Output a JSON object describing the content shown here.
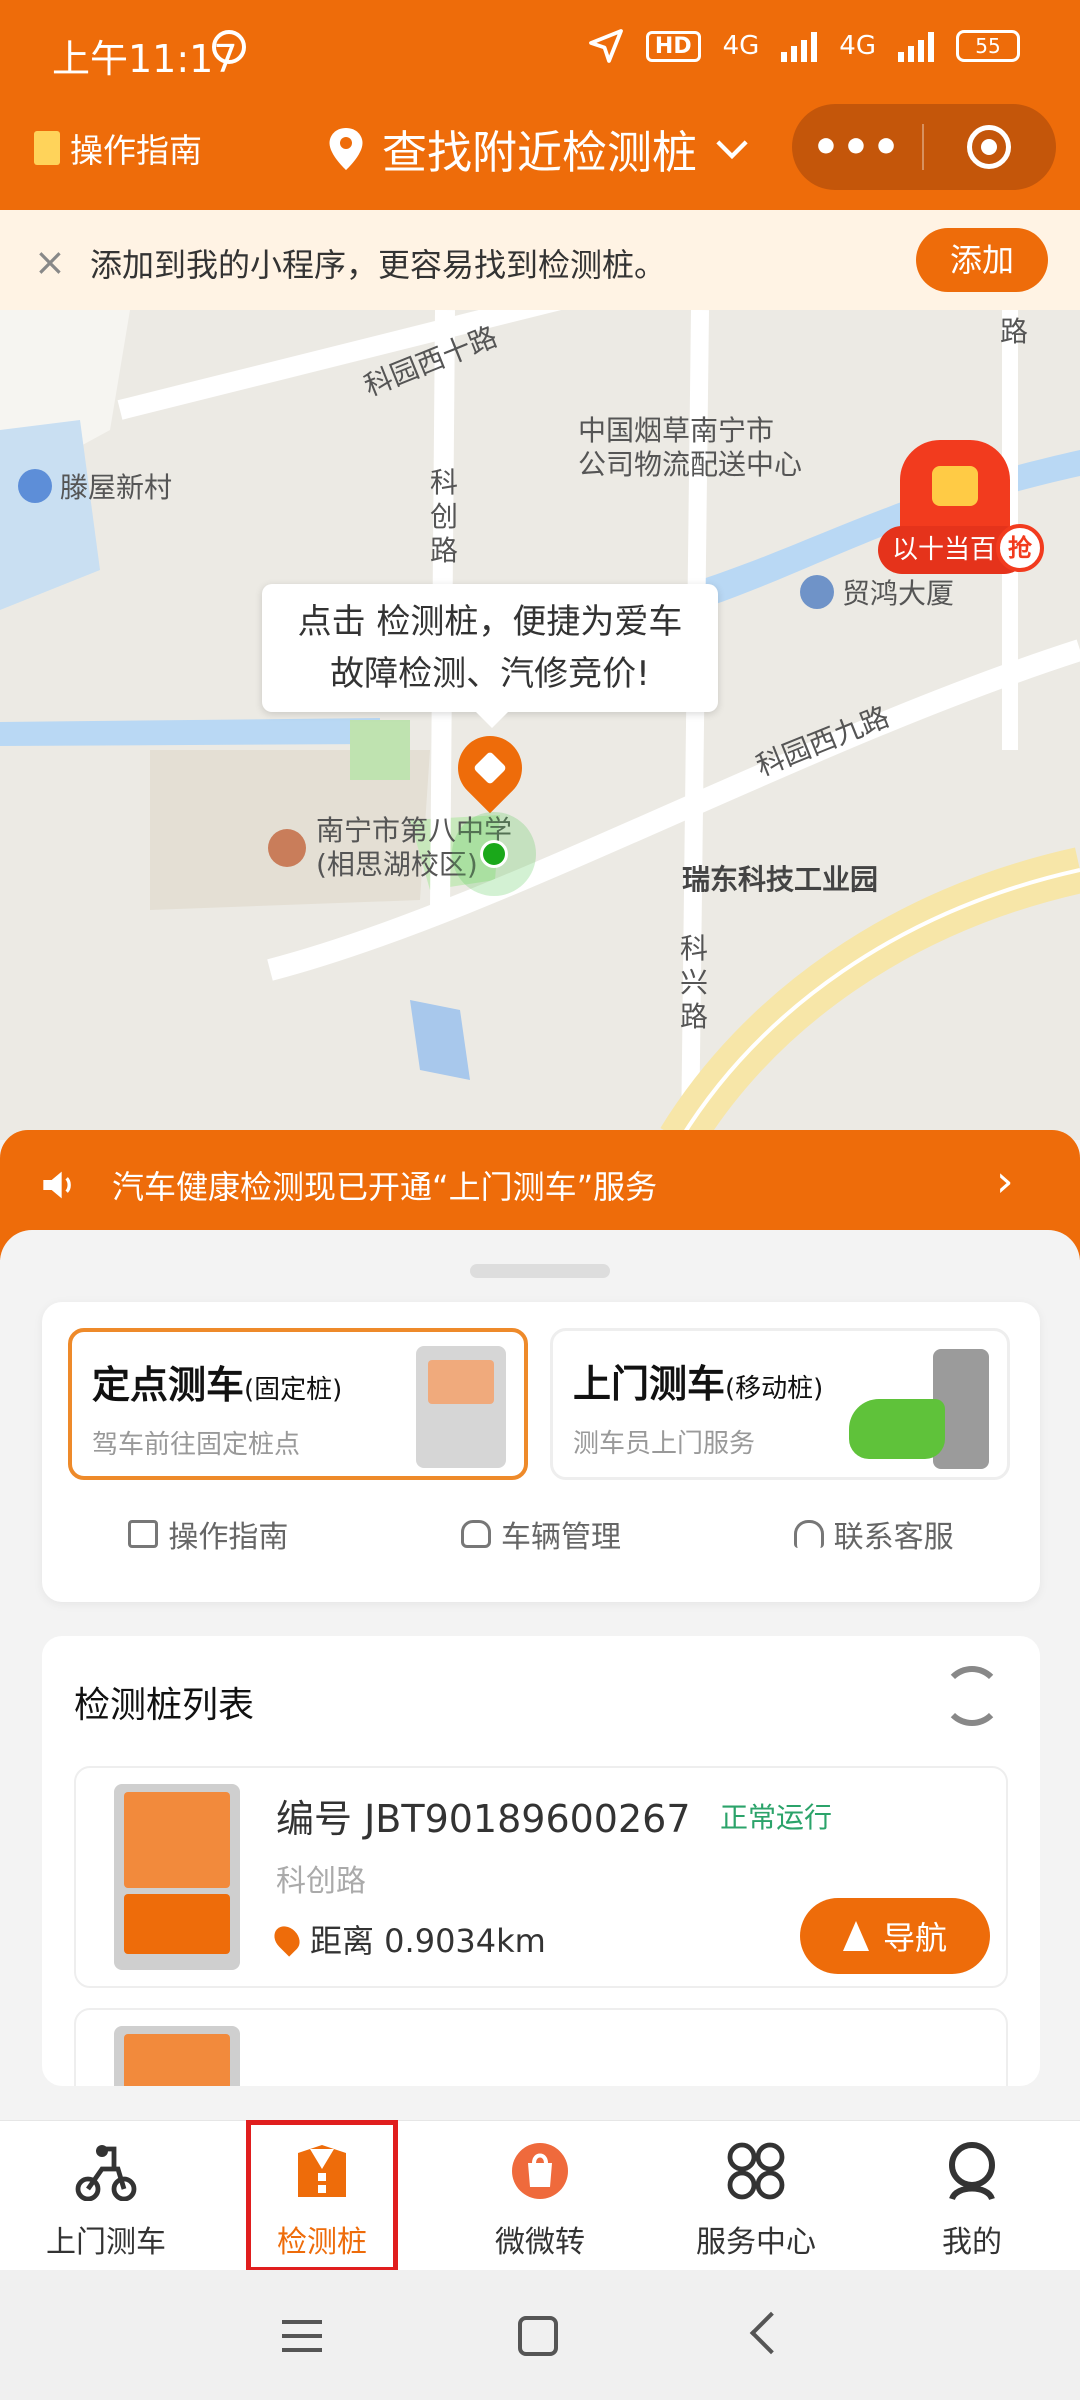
{
  "status_bar": {
    "time": "上午11:17",
    "hd": "HD",
    "net1": "4G",
    "net2": "4G",
    "battery": "55"
  },
  "header": {
    "guide_label": "操作指南",
    "title": "查找附近检测桩",
    "more_label": "•••"
  },
  "add_banner": {
    "close": "×",
    "text": "添加到我的小程序，更容易找到检测桩。",
    "button": "添加"
  },
  "map": {
    "labels": {
      "road1": "科园西十路",
      "road2": "路",
      "village": "滕屋新村",
      "company": "中国烟草南宁市公司物流配送中心",
      "company_l1": "中国烟草南宁市",
      "company_l2": "公司物流配送中心",
      "road_kc": "科创路",
      "building": "贸鸿大厦",
      "road9": "科园西九路",
      "school_l1": "南宁市第八中学",
      "school_l2": "(相思湖校区)",
      "park": "瑞东科技工业园",
      "road_kx": "科兴路"
    },
    "tooltip_line1": "点击 检测桩，便捷为爱车",
    "tooltip_line2": "故障检测、汽修竞价!",
    "redpacket_label": "以十当百",
    "redpacket_grab": "抢"
  },
  "notice": {
    "text": "汽车健康检测现已开通“上门测车”服务",
    "arrow": "›"
  },
  "modes": {
    "fixed": {
      "title": "定点测车",
      "sub": "(固定桩)",
      "desc": "驾车前往固定桩点"
    },
    "mobile": {
      "title": "上门测车",
      "sub": "(移动桩)",
      "desc": "测车员上门服务"
    }
  },
  "quick_links": [
    "操作指南",
    "车辆管理",
    "联系客服"
  ],
  "list": {
    "title": "检测桩列表",
    "stations": [
      {
        "id": "编号 JBT90189600267",
        "status": "正常运行",
        "road": "科创路",
        "distance": "距离 0.9034km",
        "nav": "导航"
      }
    ]
  },
  "tabs": [
    "上门测车",
    "检测桩",
    "微微转",
    "服务中心",
    "我的"
  ],
  "colors": {
    "brand": "#ee6c0a",
    "status_ok": "#2ba36a",
    "highlight": "#e01e1e"
  }
}
